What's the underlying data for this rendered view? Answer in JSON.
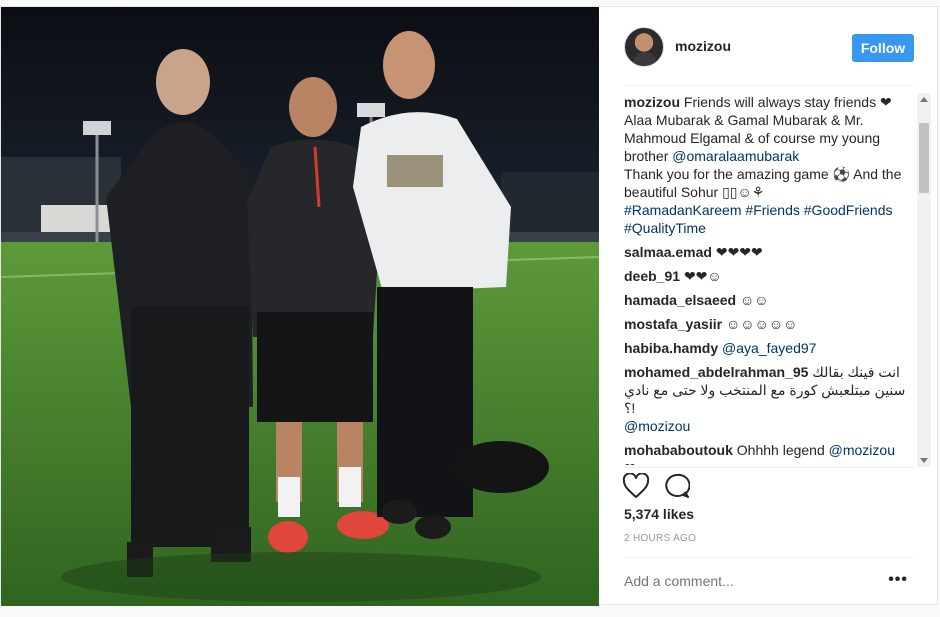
{
  "header": {
    "username": "mozizou",
    "follow_label": "Follow"
  },
  "caption": {
    "author": "mozizou",
    "line1": "Friends will always stay friends ❤",
    "line2": "Alaa Mubarak & Gamal Mubarak & Mr. Mahmoud Elgamal & of course my young brother",
    "mention": "@omaralaamubarak",
    "line3": "Thank you for the amazing game ⚽ And the beautiful Sohur ▯▯☺⚘",
    "tags": [
      "#RamadanKareem",
      "#Friends",
      "#GoodFriends",
      "#QualityTime"
    ]
  },
  "comments": [
    {
      "author": "salmaa.emad",
      "text": "❤❤❤❤"
    },
    {
      "author": "deeb_91",
      "text": "❤❤☺"
    },
    {
      "author": "hamada_elsaeed",
      "text": "☺☺"
    },
    {
      "author": "mostafa_yasiir",
      "text": "☺☺☺☺☺"
    },
    {
      "author": "habiba.hamdy",
      "mention": "@aya_fayed97"
    },
    {
      "author": "mohamed_abdelrahman_95",
      "text": "انت فينك بقالك سنين مبتلعبش كورة مع المنتخب ولا حتى مع نادي !؟",
      "mention": "@mozizou"
    },
    {
      "author": "mohababoutouk",
      "text": "Ohhhh legend",
      "mention": "@mozizou",
      "tail": "❤"
    }
  ],
  "actions": {
    "like_icon": "heart-outline-icon",
    "comment_icon": "speech-bubble-icon"
  },
  "likes": "5,374 likes",
  "timestamp": "2 HOURS AGO",
  "add_comment_placeholder": "Add a comment...",
  "more_label": "•••",
  "colors": {
    "follow_button": "#3897f0",
    "link": "#003569",
    "muted": "#999999",
    "pitch": "#3f7d2b",
    "night_sky": "#0d1116"
  }
}
